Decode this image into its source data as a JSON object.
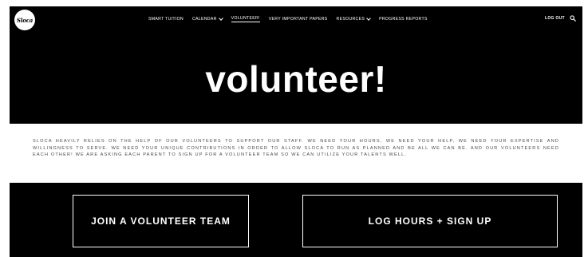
{
  "brand": {
    "logo_text": "Sloca"
  },
  "nav": {
    "items": [
      {
        "label": "SMART TUITION",
        "has_dropdown": false,
        "active": false
      },
      {
        "label": "CALENDAR",
        "has_dropdown": true,
        "active": false
      },
      {
        "label": "VOLUNTEER!",
        "has_dropdown": false,
        "active": true
      },
      {
        "label": "VERY IMPORTANT PAPERS",
        "has_dropdown": false,
        "active": false
      },
      {
        "label": "RESOURCES",
        "has_dropdown": true,
        "active": false
      },
      {
        "label": "PROGRESS REPORTS",
        "has_dropdown": false,
        "active": false
      }
    ],
    "logout_label": "LOG OUT",
    "search_icon": "search-icon"
  },
  "hero": {
    "title": "volunteer!"
  },
  "intro": {
    "text": "SLOCA HEAVILY RELIES ON THE HELP OF OUR VOLUNTEERS TO SUPPORT OUR STAFF. WE NEED YOUR HOURS, WE NEED YOUR HELP, WE NEED YOUR EXPERTISE AND WILLINGNESS TO SERVE. WE NEED YOUR UNIQUE CONTRIBUTIONS IN ORDER TO ALLOW SLOCA TO RUN AS PLANNED AND BE ALL WE CAN BE. AND OUR VOLUNTEERS NEED EACH OTHER! WE ARE ASKING EACH PARENT TO SIGN UP FOR A VOLUNTEER TEAM SO WE CAN UTILIZE YOUR TALENTS WELL."
  },
  "cta": {
    "join_label": "JOIN A VOLUNTEER TEAM",
    "log_label": "LOG HOURS + SIGN UP"
  },
  "colors": {
    "background": "#000000",
    "text": "#ffffff",
    "body_text": "#4a4a4a"
  }
}
